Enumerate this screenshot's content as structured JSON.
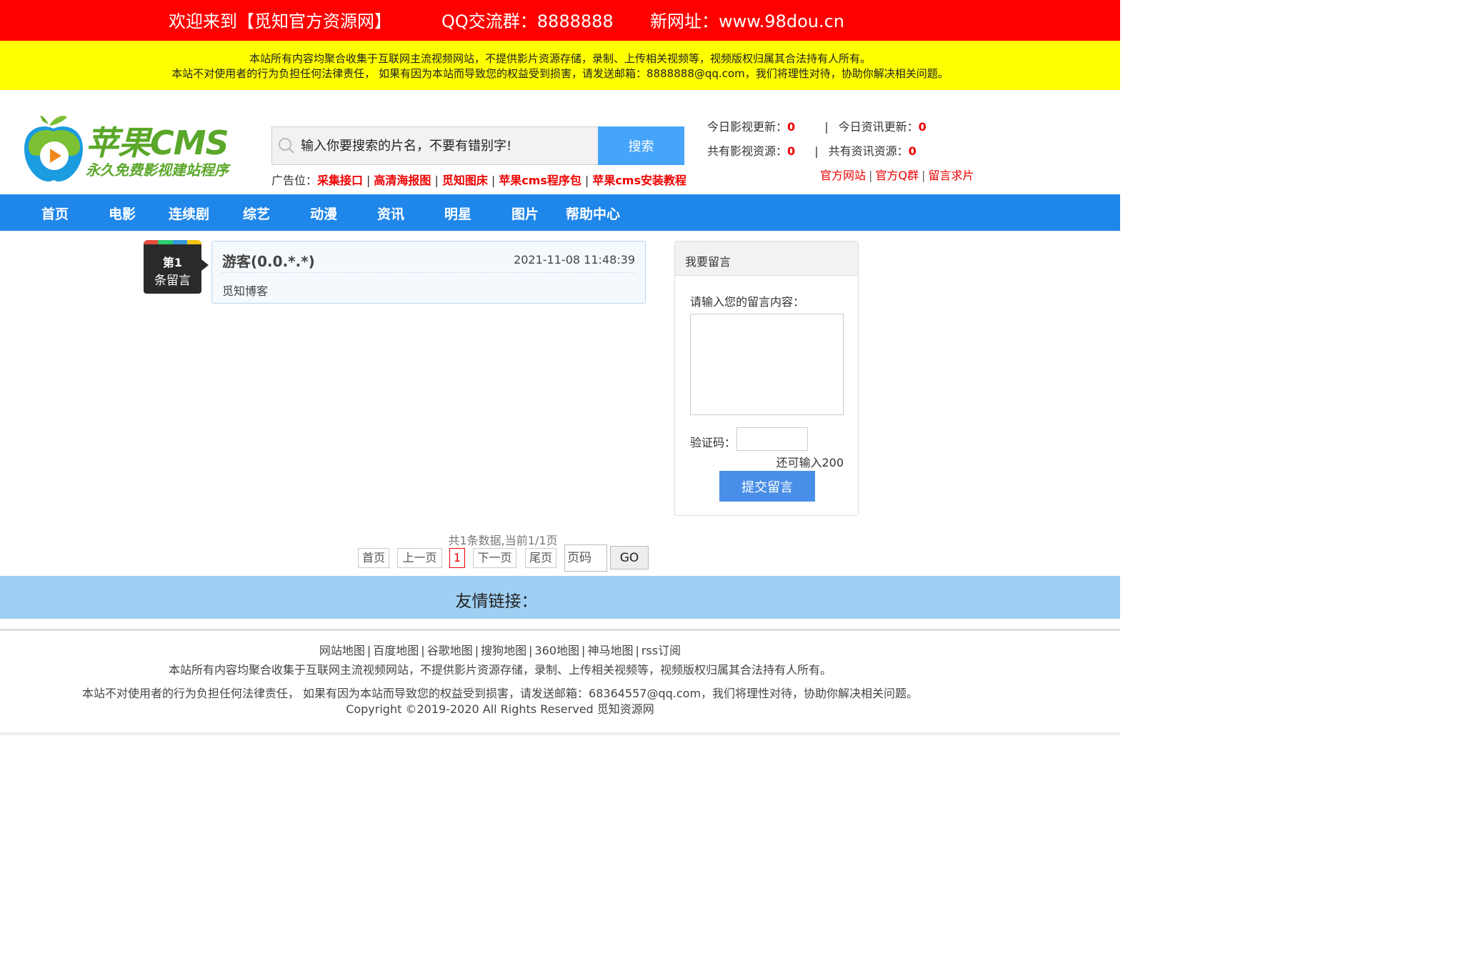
{
  "topbar": {
    "welcome": "欢迎来到【觅知官方资源网】",
    "qq_group": "QQ交流群：8888888",
    "new_url": "新网址：www.98dou.cn"
  },
  "notice": {
    "line1": "本站所有内容均聚合收集于互联网主流视频网站，不提供影片资源存储，录制、上传相关视频等，视频版权归属其合法持有人所有。",
    "line2": "本站不对使用者的行为负担任何法律责任， 如果有因为本站而导致您的权益受到损害，请发送邮箱：8888888@qq.com，我们将理性对待，协助你解决相关问题。"
  },
  "logo": {
    "main": "苹果CMS",
    "sub": "永久免费影视建站程序"
  },
  "search": {
    "placeholder": "输入你要搜索的片名，不要有错别字!",
    "button": "搜索"
  },
  "ads": {
    "label": "广告位：",
    "items": [
      "采集接口",
      "高清海报图",
      "觅知图床",
      "苹果cms程序包",
      "苹果cms安装教程"
    ],
    "sep": "|"
  },
  "stats": {
    "today_video_label": "今日影视更新：",
    "today_video": "0",
    "today_news_label": "今日资讯更新：",
    "today_news": "0",
    "total_video_label": "共有影视资源：",
    "total_video": "0",
    "total_news_label": "共有资讯资源：",
    "total_news": "0",
    "sep": "|"
  },
  "toplinks": [
    "官方网站",
    "官方Q群",
    "留言求片"
  ],
  "nav": [
    "首页",
    "电影",
    "连续剧",
    "综艺",
    "动漫",
    "资讯",
    "明星",
    "图片",
    "帮助中心"
  ],
  "message": {
    "badge_num": "第1",
    "badge_text": "条留言",
    "author": "游客(0.0.*.*)",
    "time": "2021-11-08 11:48:39",
    "body": "觅知博客"
  },
  "form": {
    "title": "我要留言",
    "content_label": "请输入您的留言内容：",
    "captcha_label": "验证码：",
    "remain": "还可输入200",
    "submit": "提交留言"
  },
  "pagination": {
    "info": "共1条数据,当前1/1页",
    "first": "首页",
    "prev": "上一页",
    "current": "1",
    "next": "下一页",
    "last": "尾页",
    "input_placeholder": "页码",
    "go": "GO"
  },
  "friend_links": {
    "title": "友情链接："
  },
  "footer": {
    "links": [
      "网站地图",
      "百度地图",
      "谷歌地图",
      "搜狗地图",
      "360地图",
      "神马地图",
      "rss订阅"
    ],
    "sep": "|",
    "line1": "本站所有内容均聚合收集于互联网主流视频网站，不提供影片资源存储，录制、上传相关视频等，视频版权归属其合法持有人所有。",
    "line2": "本站不对使用者的行为负担任何法律责任， 如果有因为本站而导致您的权益受到损害，请发送邮箱：68364557@qq.com，我们将理性对待，协助你解决相关问题。",
    "copyright": "Copyright ©2019-2020 All Rights Reserved 觅知资源网"
  },
  "colors": {
    "topbar": "#ff0000",
    "notice": "#ffff00",
    "nav": "#1f86ea",
    "accent_red": "#ee0000",
    "friend_links_bar": "#9fcff2",
    "submit_button": "#4a8fe7",
    "search_button": "#45a5fa"
  }
}
